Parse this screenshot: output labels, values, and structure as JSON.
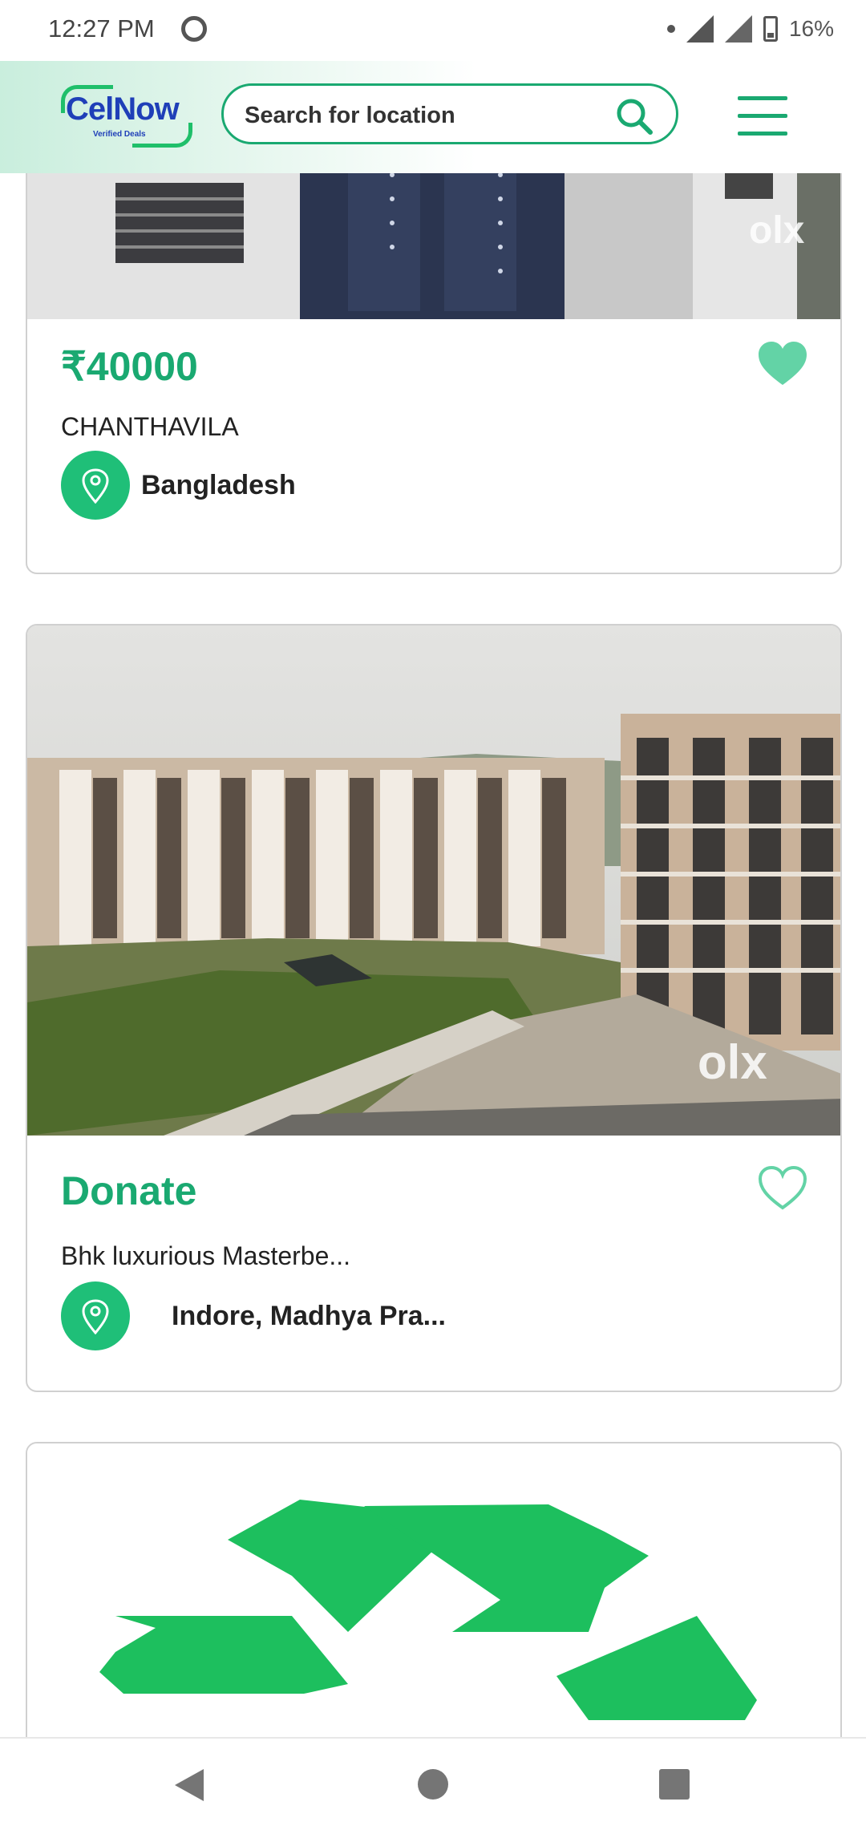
{
  "status": {
    "time": "12:27 PM",
    "battery": "16%"
  },
  "header": {
    "logo_text": "CelNow",
    "logo_sub": "Verified Deals",
    "search_placeholder": "Search for location"
  },
  "listings": [
    {
      "price": "₹40000",
      "title": "CHANTHAVILA",
      "location": "Bangladesh",
      "favorited": true,
      "watermark": "olx"
    },
    {
      "price": "Donate",
      "title": "Bhk luxurious Masterbe...",
      "location": "Indore, Madhya Pra...",
      "favorited": false,
      "watermark": "olx"
    }
  ],
  "colors": {
    "accent": "#1aa971",
    "logo_blue": "#1f3fb8",
    "recycle_green": "#1dbf5e"
  },
  "icons": [
    "search-icon",
    "menu-icon",
    "heart-icon",
    "location-pin-icon",
    "recycle-icon"
  ]
}
